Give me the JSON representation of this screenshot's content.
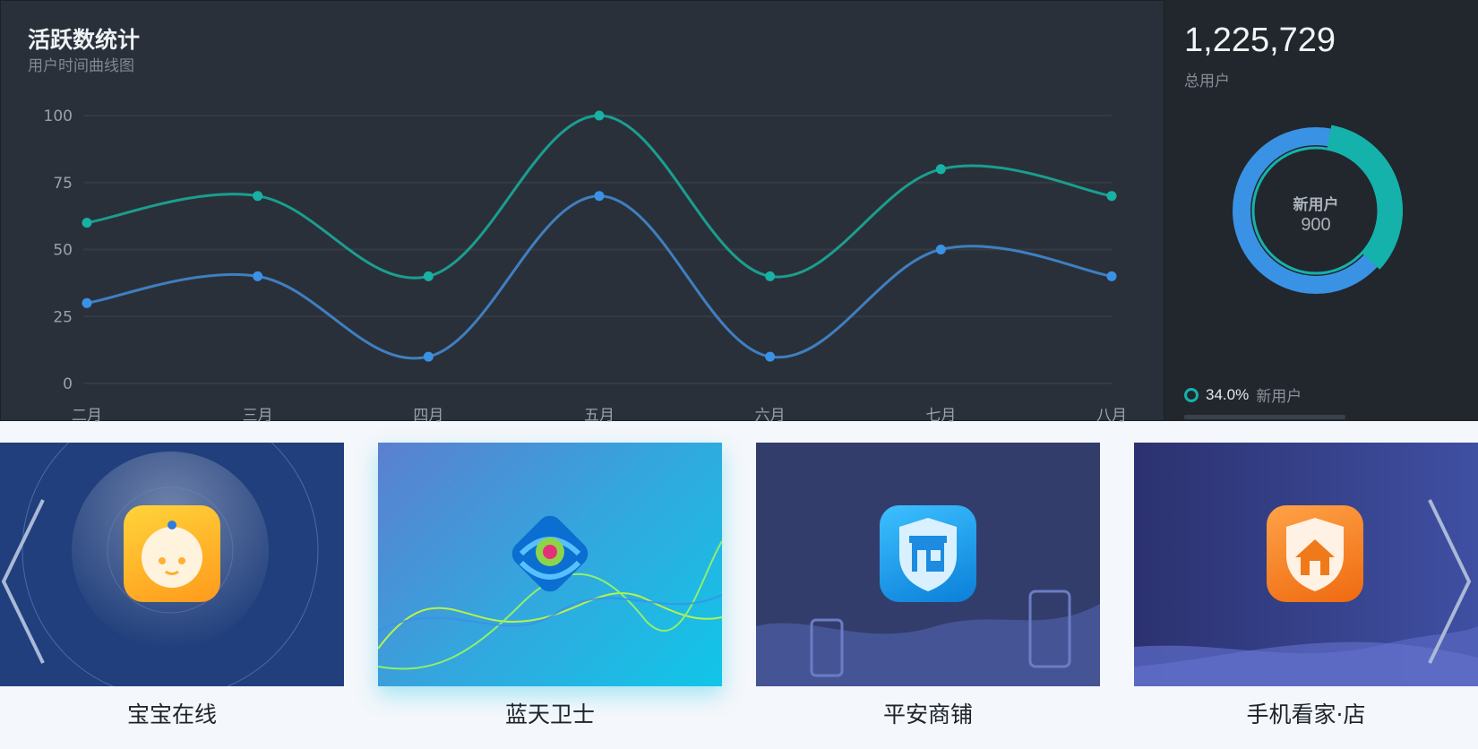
{
  "chart": {
    "title": "活跃数统计",
    "subtitle": "用户时间曲线图"
  },
  "stats": {
    "total_value": "1,225,729",
    "total_label": "总用户",
    "donut": {
      "title": "新用户",
      "value": "900",
      "fraction": 0.34
    },
    "legend": {
      "percent": "34.0%",
      "label": "新用户"
    }
  },
  "chart_data": {
    "type": "line",
    "title": "活跃数统计",
    "subtitle": "用户时间曲线图",
    "categories": [
      "二月",
      "三月",
      "四月",
      "五月",
      "六月",
      "七月",
      "八月"
    ],
    "ylim": [
      0,
      100
    ],
    "yticks": [
      0,
      25,
      50,
      75,
      100
    ],
    "grid": true,
    "smooth": true,
    "series": [
      {
        "color": "#1a9e8f",
        "values": [
          60,
          70,
          40,
          100,
          40,
          80,
          70
        ]
      },
      {
        "color": "#3f7fc1",
        "values": [
          30,
          40,
          10,
          70,
          10,
          50,
          40
        ]
      }
    ]
  },
  "carousel": {
    "items": [
      {
        "label": "宝宝在线",
        "icon": "baby-face-icon"
      },
      {
        "label": "蓝天卫士",
        "icon": "sky-guard-logo-icon"
      },
      {
        "label": "平安商铺",
        "icon": "shop-shield-icon"
      },
      {
        "label": "手机看家·店",
        "icon": "home-shield-icon"
      }
    ],
    "prev_icon": "chevron-left-icon",
    "next_icon": "chevron-right-icon"
  },
  "colors": {
    "panel_bg": "#2a3039",
    "stats_bg": "#22272e",
    "teal": "#15b2ab",
    "blue": "#3a8fe0"
  }
}
